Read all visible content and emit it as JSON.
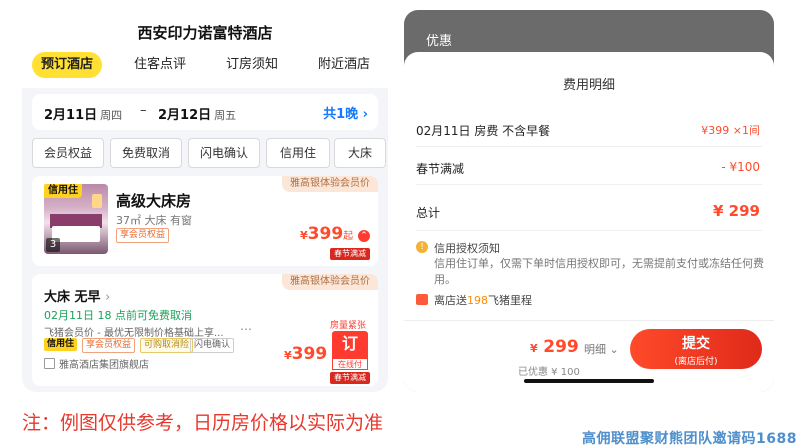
{
  "left_panel": {
    "hotel_title": "西安印力诺富特酒店",
    "tabs": [
      {
        "label": "预订酒店",
        "active": true
      },
      {
        "label": "住客点评",
        "active": false
      },
      {
        "label": "订房须知",
        "active": false
      },
      {
        "label": "附近酒店",
        "active": false
      }
    ],
    "dates": {
      "checkin": "2月11日",
      "checkin_weekday": "周四",
      "separator": "–",
      "checkout": "2月12日",
      "checkout_weekday": "周五",
      "nights": "共1晚",
      "nights_icon": "chevron-right-icon"
    },
    "filters": [
      "会员权益",
      "免费取消",
      "闪电确认",
      "信用住",
      "大床"
    ],
    "room": {
      "credit_badge": "信用住",
      "tier_strip": "雅高银体验会员价",
      "name": "高级大床房",
      "meta": "37㎡ 大床 有窗",
      "member_tag": "享会员权益",
      "image_count": "3",
      "price_currency": "¥",
      "price": "399",
      "price_suffix": "起",
      "promo": "春节满减"
    },
    "rate": {
      "tier_strip": "雅高银体验会员价",
      "name": "大床  无早",
      "cancel": "02月11日 18 点前可免费取消",
      "desc": "飞猪会员价 - 最优无限制价格基础上享...",
      "more": "⋯",
      "tags": [
        "信用住",
        "享会员权益",
        "可购取消险",
        "闪电确认"
      ],
      "group": "雅高酒店集团旗舰店",
      "scarce": "房量紧张",
      "book_label": "订",
      "book_sub": "在线付",
      "price_currency": "¥",
      "price": "399",
      "promo": "春节满减"
    },
    "footnote": "注：例图仅供参考，日历房价格以实际为准"
  },
  "right_panel": {
    "top_label": "优惠",
    "sheet_title": "费用明细",
    "rows": [
      {
        "label": "02月11日 房费 不含早餐",
        "value": "¥399 ×1间"
      },
      {
        "label": "春节满减",
        "value": "- ¥100"
      },
      {
        "label": "总计",
        "value": "¥ 299"
      }
    ],
    "notice_title": "信用授权须知",
    "notice_body": "信用住订单，仅需下单时信用授权即可，无需提前支付或冻结任何费用。",
    "gift_prefix": "离店送",
    "gift_highlight": "198",
    "gift_suffix": "飞猪里程",
    "bottom": {
      "price_currency": "¥",
      "price": "299",
      "detail": "明细",
      "saved": "已优惠 ¥ 100",
      "submit": "提交",
      "submit_sub": "(离店后付)"
    }
  },
  "watermark": "高佣联盟聚财熊团队邀请码1688",
  "colors": {
    "accent_yellow": "#ffe033",
    "price_red": "#ff4b2b",
    "link_blue": "#1677ff",
    "green": "#1aa35a"
  }
}
